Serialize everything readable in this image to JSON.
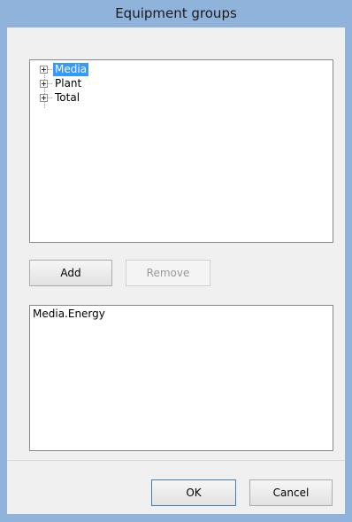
{
  "window": {
    "title": "Equipment groups"
  },
  "tree": {
    "nodes": [
      {
        "label": "Media",
        "selected": true
      },
      {
        "label": "Plant",
        "selected": false
      },
      {
        "label": "Total",
        "selected": false
      }
    ]
  },
  "buttons": {
    "add": "Add",
    "remove": "Remove",
    "ok": "OK",
    "cancel": "Cancel"
  },
  "selected_list": {
    "items": [
      "Media.Energy"
    ]
  },
  "colors": {
    "title_bar": "#8fb3da",
    "selection": "#3399ff"
  }
}
